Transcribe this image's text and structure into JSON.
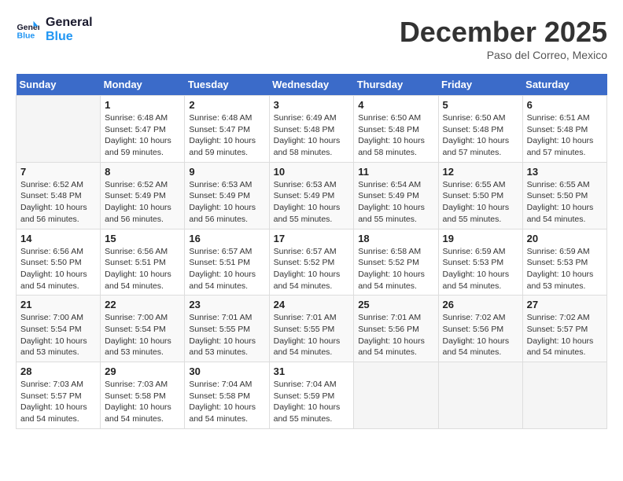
{
  "logo": {
    "line1": "General",
    "line2": "Blue"
  },
  "title": "December 2025",
  "location": "Paso del Correo, Mexico",
  "days_header": [
    "Sunday",
    "Monday",
    "Tuesday",
    "Wednesday",
    "Thursday",
    "Friday",
    "Saturday"
  ],
  "weeks": [
    [
      {
        "num": "",
        "info": ""
      },
      {
        "num": "1",
        "info": "Sunrise: 6:48 AM\nSunset: 5:47 PM\nDaylight: 10 hours\nand 59 minutes."
      },
      {
        "num": "2",
        "info": "Sunrise: 6:48 AM\nSunset: 5:47 PM\nDaylight: 10 hours\nand 59 minutes."
      },
      {
        "num": "3",
        "info": "Sunrise: 6:49 AM\nSunset: 5:48 PM\nDaylight: 10 hours\nand 58 minutes."
      },
      {
        "num": "4",
        "info": "Sunrise: 6:50 AM\nSunset: 5:48 PM\nDaylight: 10 hours\nand 58 minutes."
      },
      {
        "num": "5",
        "info": "Sunrise: 6:50 AM\nSunset: 5:48 PM\nDaylight: 10 hours\nand 57 minutes."
      },
      {
        "num": "6",
        "info": "Sunrise: 6:51 AM\nSunset: 5:48 PM\nDaylight: 10 hours\nand 57 minutes."
      }
    ],
    [
      {
        "num": "7",
        "info": "Sunrise: 6:52 AM\nSunset: 5:48 PM\nDaylight: 10 hours\nand 56 minutes."
      },
      {
        "num": "8",
        "info": "Sunrise: 6:52 AM\nSunset: 5:49 PM\nDaylight: 10 hours\nand 56 minutes."
      },
      {
        "num": "9",
        "info": "Sunrise: 6:53 AM\nSunset: 5:49 PM\nDaylight: 10 hours\nand 56 minutes."
      },
      {
        "num": "10",
        "info": "Sunrise: 6:53 AM\nSunset: 5:49 PM\nDaylight: 10 hours\nand 55 minutes."
      },
      {
        "num": "11",
        "info": "Sunrise: 6:54 AM\nSunset: 5:49 PM\nDaylight: 10 hours\nand 55 minutes."
      },
      {
        "num": "12",
        "info": "Sunrise: 6:55 AM\nSunset: 5:50 PM\nDaylight: 10 hours\nand 55 minutes."
      },
      {
        "num": "13",
        "info": "Sunrise: 6:55 AM\nSunset: 5:50 PM\nDaylight: 10 hours\nand 54 minutes."
      }
    ],
    [
      {
        "num": "14",
        "info": "Sunrise: 6:56 AM\nSunset: 5:50 PM\nDaylight: 10 hours\nand 54 minutes."
      },
      {
        "num": "15",
        "info": "Sunrise: 6:56 AM\nSunset: 5:51 PM\nDaylight: 10 hours\nand 54 minutes."
      },
      {
        "num": "16",
        "info": "Sunrise: 6:57 AM\nSunset: 5:51 PM\nDaylight: 10 hours\nand 54 minutes."
      },
      {
        "num": "17",
        "info": "Sunrise: 6:57 AM\nSunset: 5:52 PM\nDaylight: 10 hours\nand 54 minutes."
      },
      {
        "num": "18",
        "info": "Sunrise: 6:58 AM\nSunset: 5:52 PM\nDaylight: 10 hours\nand 54 minutes."
      },
      {
        "num": "19",
        "info": "Sunrise: 6:59 AM\nSunset: 5:53 PM\nDaylight: 10 hours\nand 54 minutes."
      },
      {
        "num": "20",
        "info": "Sunrise: 6:59 AM\nSunset: 5:53 PM\nDaylight: 10 hours\nand 53 minutes."
      }
    ],
    [
      {
        "num": "21",
        "info": "Sunrise: 7:00 AM\nSunset: 5:54 PM\nDaylight: 10 hours\nand 53 minutes."
      },
      {
        "num": "22",
        "info": "Sunrise: 7:00 AM\nSunset: 5:54 PM\nDaylight: 10 hours\nand 53 minutes."
      },
      {
        "num": "23",
        "info": "Sunrise: 7:01 AM\nSunset: 5:55 PM\nDaylight: 10 hours\nand 53 minutes."
      },
      {
        "num": "24",
        "info": "Sunrise: 7:01 AM\nSunset: 5:55 PM\nDaylight: 10 hours\nand 54 minutes."
      },
      {
        "num": "25",
        "info": "Sunrise: 7:01 AM\nSunset: 5:56 PM\nDaylight: 10 hours\nand 54 minutes."
      },
      {
        "num": "26",
        "info": "Sunrise: 7:02 AM\nSunset: 5:56 PM\nDaylight: 10 hours\nand 54 minutes."
      },
      {
        "num": "27",
        "info": "Sunrise: 7:02 AM\nSunset: 5:57 PM\nDaylight: 10 hours\nand 54 minutes."
      }
    ],
    [
      {
        "num": "28",
        "info": "Sunrise: 7:03 AM\nSunset: 5:57 PM\nDaylight: 10 hours\nand 54 minutes."
      },
      {
        "num": "29",
        "info": "Sunrise: 7:03 AM\nSunset: 5:58 PM\nDaylight: 10 hours\nand 54 minutes."
      },
      {
        "num": "30",
        "info": "Sunrise: 7:04 AM\nSunset: 5:58 PM\nDaylight: 10 hours\nand 54 minutes."
      },
      {
        "num": "31",
        "info": "Sunrise: 7:04 AM\nSunset: 5:59 PM\nDaylight: 10 hours\nand 55 minutes."
      },
      {
        "num": "",
        "info": ""
      },
      {
        "num": "",
        "info": ""
      },
      {
        "num": "",
        "info": ""
      }
    ]
  ]
}
